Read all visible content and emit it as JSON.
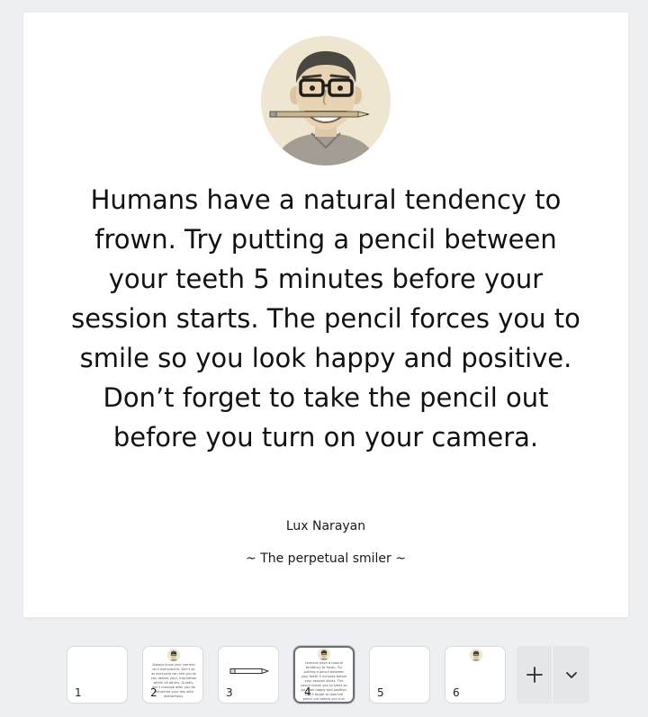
{
  "slide": {
    "quote": "Humans have a natural tendency to frown. Try putting a pencil between your teeth 5 minutes before your session starts. The pencil forces you to smile so you look happy and positive. Don’t forget to take the pencil out before you turn on your camera.",
    "author": "Lux Narayan",
    "tagline": "~ The perpetual smiler ~",
    "avatar_icon": "smiling-man-with-pencil-illustration"
  },
  "filmstrip": {
    "active_index": 4,
    "thumbs": [
      {
        "number": "1"
      },
      {
        "number": "2",
        "mini_text": "Always know your camera isn't everywhere, Don't sit as everyone can see you as you deliver your, inspiration within all others. Quietly, don't manage after you be distracted your day with distractions."
      },
      {
        "number": "3"
      },
      {
        "number": "4",
        "mini_text": "Humans have a natural tendency to frown. Try putting a pencil between your teeth 5 minutes before your session starts. The pencil forces you to smile so you look happy and positive. Don't forget to take the pencil out before you turn on your camera."
      },
      {
        "number": "5"
      },
      {
        "number": "6"
      }
    ]
  },
  "controls": {
    "add_icon": "plus-icon",
    "more_icon": "chevron-down-icon"
  },
  "colors": {
    "page_background": "#eeeff2",
    "slide_background": "#ffffff",
    "avatar_background": "#efe6d2",
    "button_background": "#e5e6ea"
  }
}
